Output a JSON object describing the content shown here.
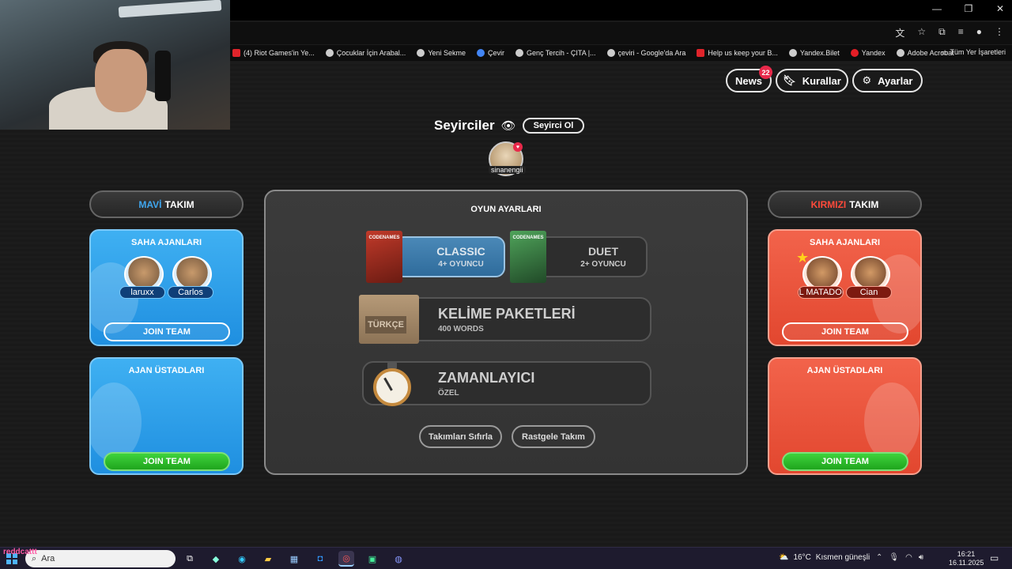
{
  "browser": {
    "window_controls": [
      "—",
      "❐",
      "✕"
    ],
    "bookmarks": [
      {
        "label": "(4) Riot Games'in Ye...",
        "icon": "youtube-icon"
      },
      {
        "label": "Çocuklar İçin Arabal...",
        "icon": "google-icon"
      },
      {
        "label": "Yeni Sekme",
        "icon": "globe-icon"
      },
      {
        "label": "Çevir",
        "icon": "translate-icon"
      },
      {
        "label": "Genç Tercih - ÇITA |...",
        "icon": "google-icon"
      },
      {
        "label": "çeviri - Google'da Ara",
        "icon": "google-icon"
      },
      {
        "label": "Help us keep your B...",
        "icon": "gmail-icon"
      },
      {
        "label": "Yandex.Bilet",
        "icon": "globe-icon"
      },
      {
        "label": "Yandex",
        "icon": "yandex-icon"
      },
      {
        "label": "Adobe Acrobat",
        "icon": "globe-icon"
      }
    ],
    "all_bookmarks_label": "Tüm Yer İşaretleri"
  },
  "header": {
    "news_label": "News",
    "news_count": "22",
    "rules_label": "Kurallar",
    "settings_label": "Ayarlar"
  },
  "spectators": {
    "title": "Seyirciler",
    "button_label": "Seyirci Ol",
    "spectator_name": "sinanengii"
  },
  "blue_team": {
    "title_accent": "MAVİ",
    "title_rest": "TAKIM",
    "agents_title": "SAHA AJANLARI",
    "agents": [
      "laruxx",
      "Carlos"
    ],
    "agents_join": "JOIN TEAM",
    "masters_title": "AJAN ÜSTADLARI",
    "masters_join": "JOIN TEAM"
  },
  "red_team": {
    "title_accent": "KIRMIZI",
    "title_rest": "TAKIM",
    "agents_title": "SAHA AJANLARI",
    "agents": [
      "EL MATADOR",
      "Cian"
    ],
    "agents_join": "JOIN TEAM",
    "masters_title": "AJAN ÜSTADLARI",
    "masters_join": "JOIN TEAM"
  },
  "game_settings": {
    "title": "OYUN AYARLARI",
    "box_label": "CODENAMES",
    "classic_label": "CLASSIC",
    "classic_sub": "4+ OYUNCU",
    "duet_label": "DUET",
    "duet_sub": "2+ OYUNCU",
    "words_label": "KELİME PAKETLERİ",
    "words_sub": "400 WORDS",
    "words_box": "TÜRKÇE",
    "timer_label": "ZAMANLAYICI",
    "timer_sub": "ÖZEL",
    "reset_label": "Takımları Sıfırla",
    "random_label": "Rastgele Takım"
  },
  "taskbar": {
    "search_placeholder": "Ara",
    "weather_temp": "16°C",
    "weather_text": "Kısmen güneşli",
    "time": "16:21",
    "date": "16.11.2025",
    "overlay_name": "reddcattt"
  },
  "colors": {
    "blue_team": "#1f8fe0",
    "red_team": "#e2472f",
    "join_green": "#1fa51d",
    "news_badge": "#e8294a"
  }
}
